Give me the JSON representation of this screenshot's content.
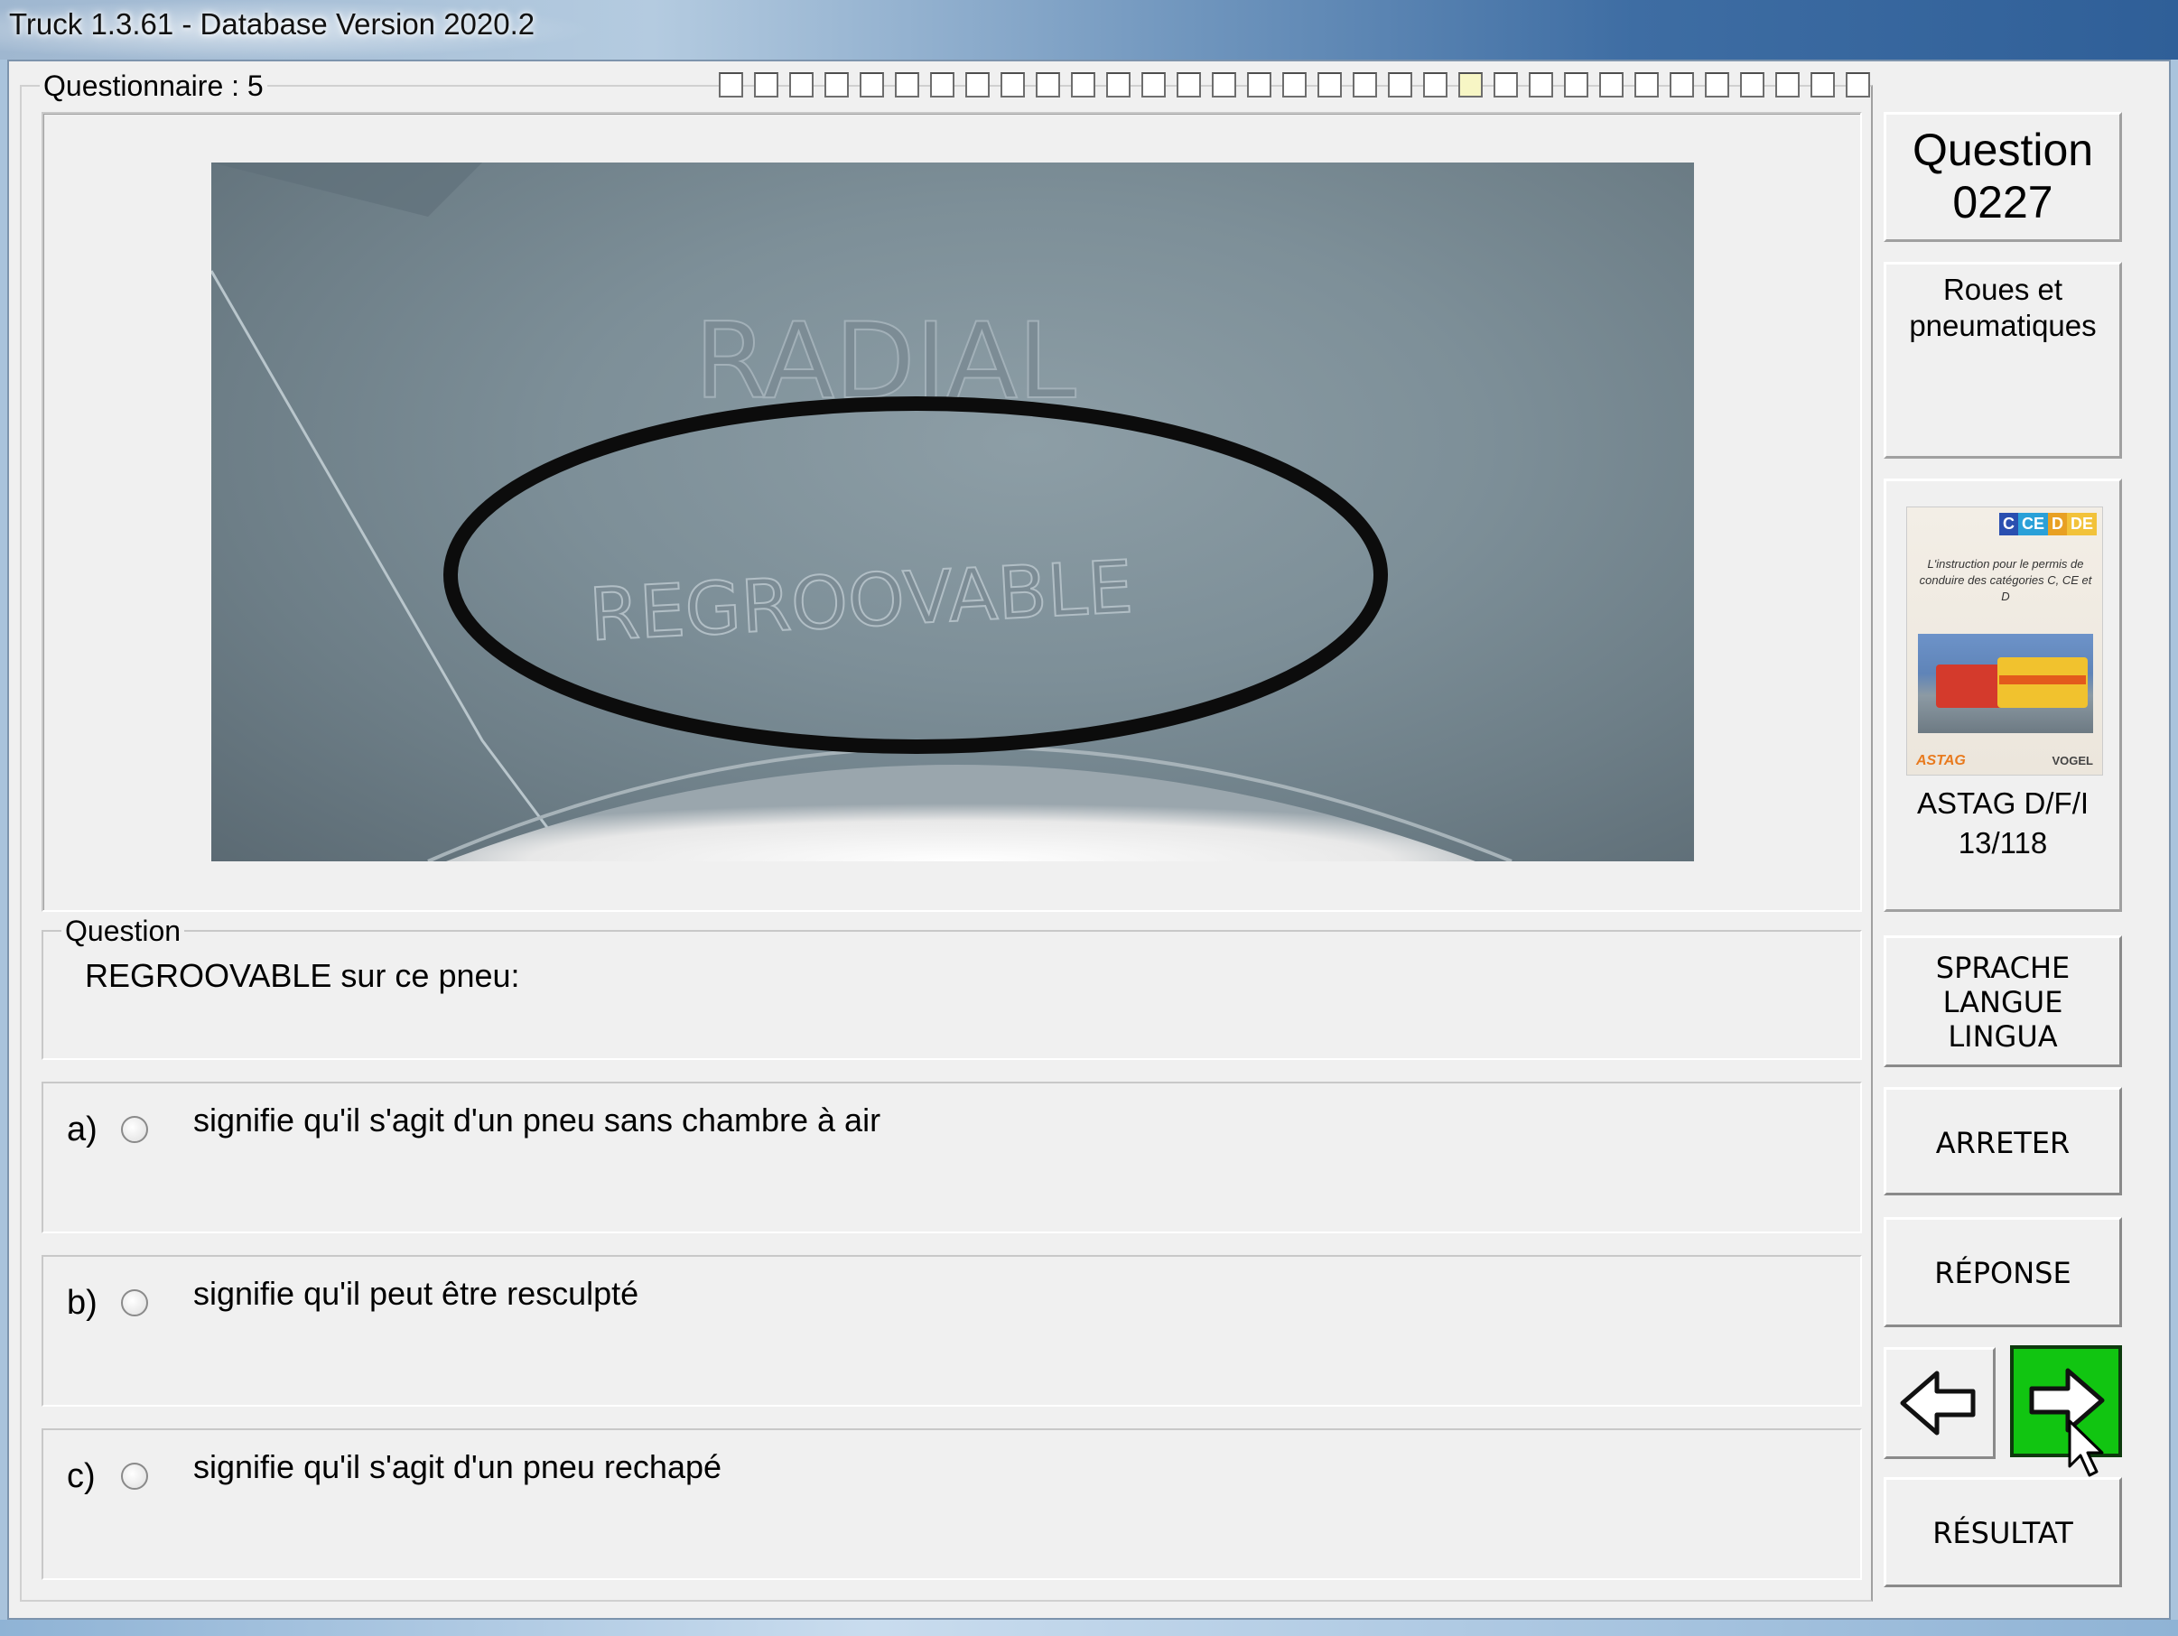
{
  "window": {
    "title": "Truck 1.3.61 - Database Version 2020.2"
  },
  "questionnaire": {
    "label": "Questionnaire : 5",
    "progress": {
      "total": 33,
      "current": 22
    }
  },
  "image": {
    "words": [
      "RADIAL",
      "REGROOVABLE"
    ]
  },
  "question": {
    "legend": "Question",
    "text": "REGROOVABLE sur ce pneu:"
  },
  "answers": [
    {
      "letter": "a)",
      "text": "signifie qu'il s'agit d'un pneu sans chambre à air",
      "selected": false
    },
    {
      "letter": "b)",
      "text": "signifie qu'il peut être resculpté",
      "selected": false
    },
    {
      "letter": "c)",
      "text": "signifie qu'il s'agit d'un pneu rechapé",
      "selected": false
    }
  ],
  "side": {
    "question_label": "Question",
    "question_number": "0227",
    "category_line1": "Roues et",
    "category_line2": "pneumatiques",
    "book": {
      "tags": [
        "C",
        "CE",
        "D",
        "DE"
      ],
      "cover_text": "L'instruction pour le permis de conduire des catégories C, CE et D",
      "publisher_left": "ASTAG",
      "publisher_right": "VOGEL",
      "ref_line1": "ASTAG D/F/I",
      "ref_line2": "13/118"
    },
    "buttons": {
      "language_1": "SPRACHE",
      "language_2": "LANGUE",
      "language_3": "LINGUA",
      "stop": "ARRETER",
      "answer": "RÉPONSE",
      "result": "RÉSULTAT"
    }
  },
  "colors": {
    "next_button": "#11c511",
    "titlebar": "#3e6da3",
    "window_bg": "#f0f0f0"
  }
}
